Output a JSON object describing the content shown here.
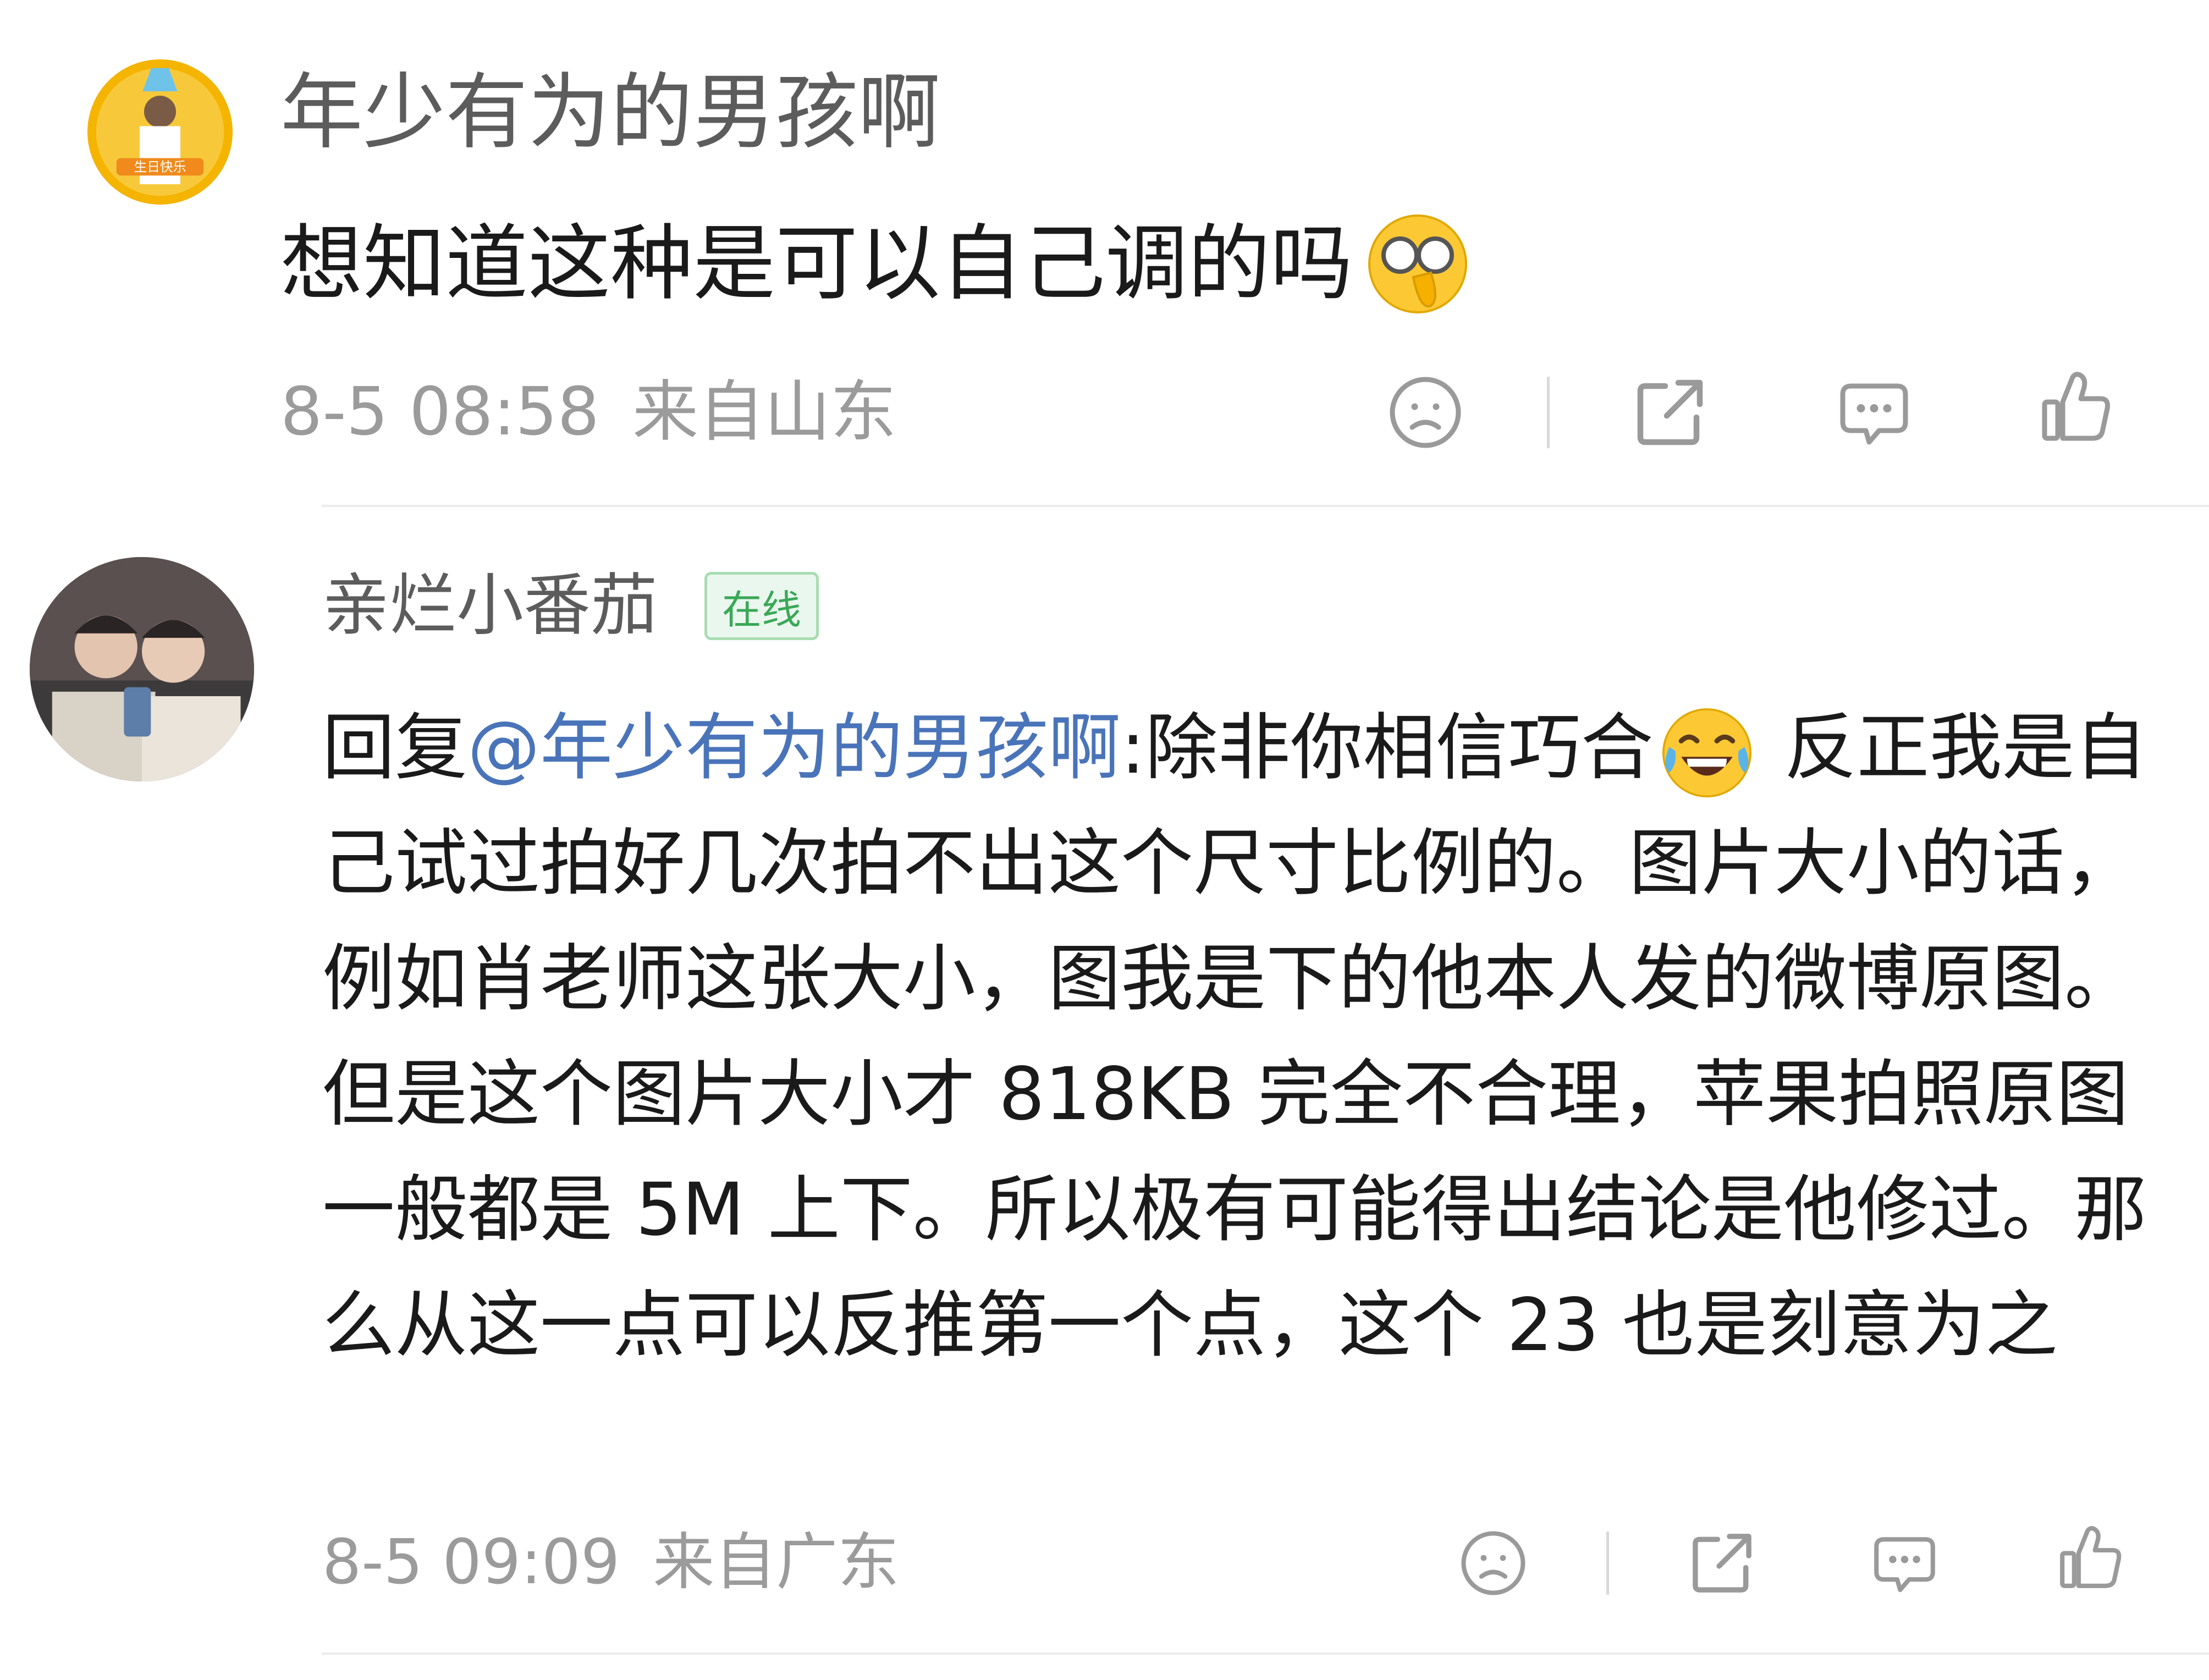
{
  "comment": {
    "username": "年少有为的男孩啊",
    "avatar_badge": "生日快乐",
    "text": "想知道这种是可以自己调的吗",
    "emoji": "facepalm-glasses-emoji",
    "date": "8-5 08:58",
    "location": "来自山东"
  },
  "reply": {
    "username": "亲烂小番茄",
    "status_badge": "在线",
    "prefix": "回复",
    "mention": "@年少有为的男孩啊",
    "colon": ":",
    "text_part1": "除非你相信巧合",
    "emoji": "tears-of-joy-emoji",
    "text_part2": " 反正我是自己试过拍好几次拍不出这个尺寸比例的。图片大小的话，例如肖老师这张大小，图我是下的他本人发的微博原图。但是这个图片大小才 818KB 完全不合理，苹果拍照原图一般都是 5M 上下。所以极有可能得出结论是他修过。那么从这一点可以反推第一个点，这个 23 也是刻意为之",
    "date": "8-5 09:09",
    "location": "来自广东"
  },
  "actions": [
    "dislike-icon",
    "share-icon",
    "comment-icon",
    "like-icon"
  ],
  "colors": {
    "mention": "#4a74b9",
    "meta": "#9b9b9b",
    "online_badge": "#3aa857",
    "icon": "#9a9a9a"
  }
}
